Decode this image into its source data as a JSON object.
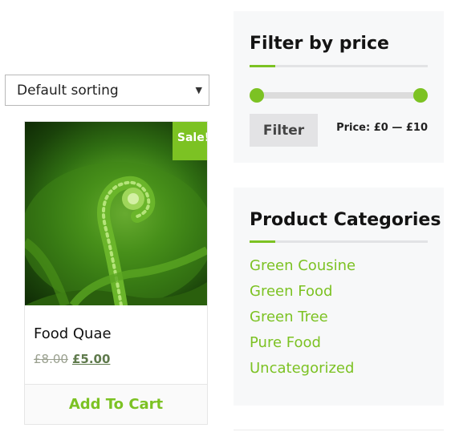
{
  "shop": {
    "sorting": {
      "selected": "Default sorting"
    }
  },
  "product": {
    "title": "Food Quae",
    "sale_badge": "Sale!",
    "old_price": "£8.00",
    "new_price": "£5.00",
    "add_to_cart": "Add To Cart"
  },
  "sidebar": {
    "price_filter": {
      "title": "Filter by price",
      "button": "Filter",
      "range_label": "Price: £0 — £10",
      "range_min": 0,
      "range_max": 10
    },
    "categories": {
      "title": "Product Categories",
      "items": [
        "Green Cousine",
        "Green Food",
        "Green Tree",
        "Pure Food",
        "Uncategorized"
      ]
    }
  },
  "colors": {
    "accent": "#7cc223",
    "widget_bg": "#f7f8f9"
  }
}
